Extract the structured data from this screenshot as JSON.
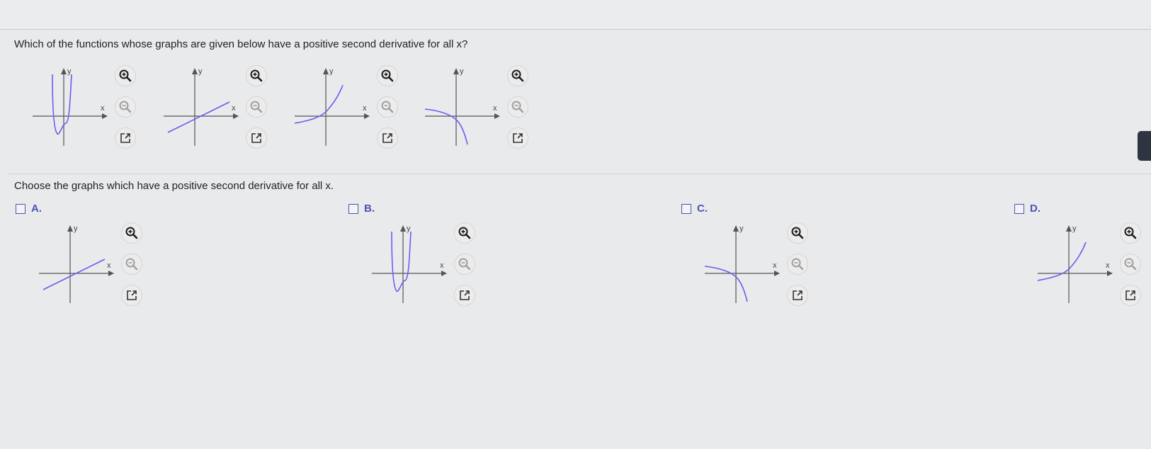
{
  "question": {
    "text": "Which of the functions whose graphs are given below have a positive second derivative for all x?"
  },
  "instruction": {
    "text": "Choose the graphs which have a positive second derivative for all x."
  },
  "axis_labels": {
    "x": "x",
    "y": "y"
  },
  "colors": {
    "curve": "#6a5cf0",
    "axis": "#555555",
    "choice_label": "#4a53b6",
    "background": "#e9eaec"
  },
  "icons": {
    "zoom_in": "zoom-in-icon",
    "zoom_out": "zoom-out-icon",
    "popout": "external-link-icon"
  },
  "given_graphs": [
    {
      "curve": "quartic-w"
    },
    {
      "curve": "line"
    },
    {
      "curve": "exp-increasing"
    },
    {
      "curve": "concave-decreasing"
    }
  ],
  "choices": [
    {
      "label": "A.",
      "curve": "line",
      "checked": false
    },
    {
      "label": "B.",
      "curve": "quartic-w",
      "checked": false
    },
    {
      "label": "C.",
      "curve": "concave-decreasing",
      "checked": false
    },
    {
      "label": "D.",
      "curve": "exp-increasing",
      "checked": false
    }
  ]
}
